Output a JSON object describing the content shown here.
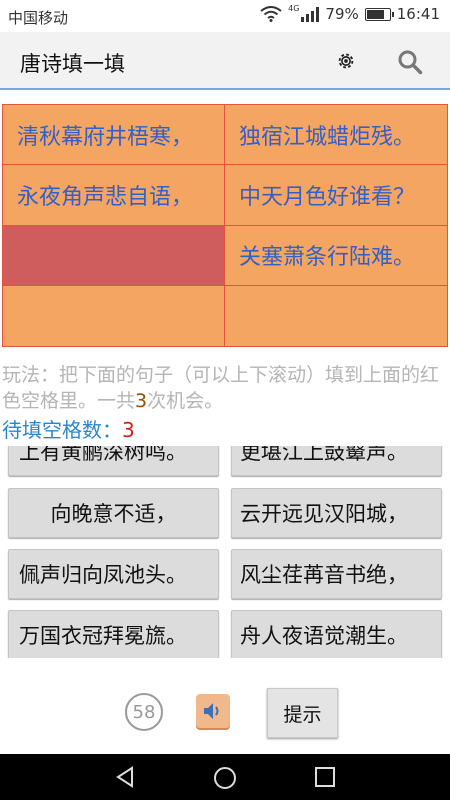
{
  "status": {
    "carrier": "中国移动",
    "network": "4G",
    "battery": "79%",
    "battery_level": 0.79,
    "time": "16:41"
  },
  "appbar": {
    "title": "唐诗填一填",
    "settings_icon": "gear-icon",
    "search_icon": "search-icon"
  },
  "poem": {
    "lines": [
      "清秋幕府井梧寒，",
      "独宿江城蜡炬残。",
      "永夜角声悲自语，",
      "中天月色好谁看？",
      "",
      "关塞萧条行陆难。",
      "",
      ""
    ],
    "highlighted_index": 4
  },
  "instructions": {
    "text_before": "玩法：把下面的句子（可以上下滚动）填到上面的红色空格里。一共",
    "chances": "3",
    "text_after": "次机会。"
  },
  "blank_count": {
    "label": "待填空格数：",
    "value": "3"
  },
  "answers": [
    {
      "left": "上有黄鹂深树鸣。",
      "right": "更堪江上鼓鼙声。"
    },
    {
      "left": "向晚意不适，",
      "right": "云开远见汉阳城，"
    },
    {
      "left": "佩声归向凤池头。",
      "right": "风尘荏苒音书绝，"
    },
    {
      "left": "万国衣冠拜冕旒。",
      "right": "舟人夜语觉潮生。"
    }
  ],
  "controls": {
    "timer": "58",
    "speaker_icon": "speaker-icon",
    "hint_label": "提示"
  },
  "colors": {
    "grid_bg": "#f5a562",
    "grid_border": "#e5533b",
    "highlight": "#cf5d5d",
    "poem_text": "#3360c7",
    "accent_blue": "#2a86c8"
  }
}
